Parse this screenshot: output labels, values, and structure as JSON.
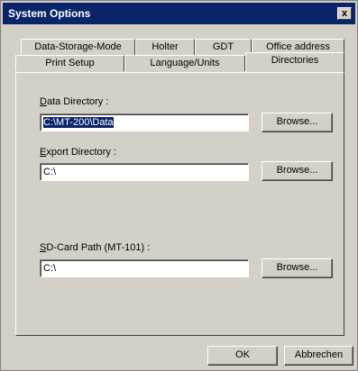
{
  "window": {
    "title": "System Options",
    "close_label": "x"
  },
  "tabs_row1": [
    {
      "label": "Data-Storage-Mode"
    },
    {
      "label": "Holter"
    },
    {
      "label": "GDT"
    },
    {
      "label": "Office address"
    }
  ],
  "tabs_row2": [
    {
      "label": "Print Setup"
    },
    {
      "label": "Language/Units"
    },
    {
      "label": "Directories",
      "active": true
    }
  ],
  "directories": {
    "data_label_accel": "D",
    "data_label_rest": "ata Directory :",
    "data_value": "C:\\MT-200\\Data",
    "export_label_accel": "E",
    "export_label_rest": "xport Directory :",
    "export_value": "C:\\",
    "sd_label_accel": "S",
    "sd_label_rest": "D-Card Path (MT-101) :",
    "sd_value": "C:\\",
    "browse_label": "Browse..."
  },
  "footer": {
    "ok_label": "OK",
    "cancel_label": "Abbrechen"
  }
}
